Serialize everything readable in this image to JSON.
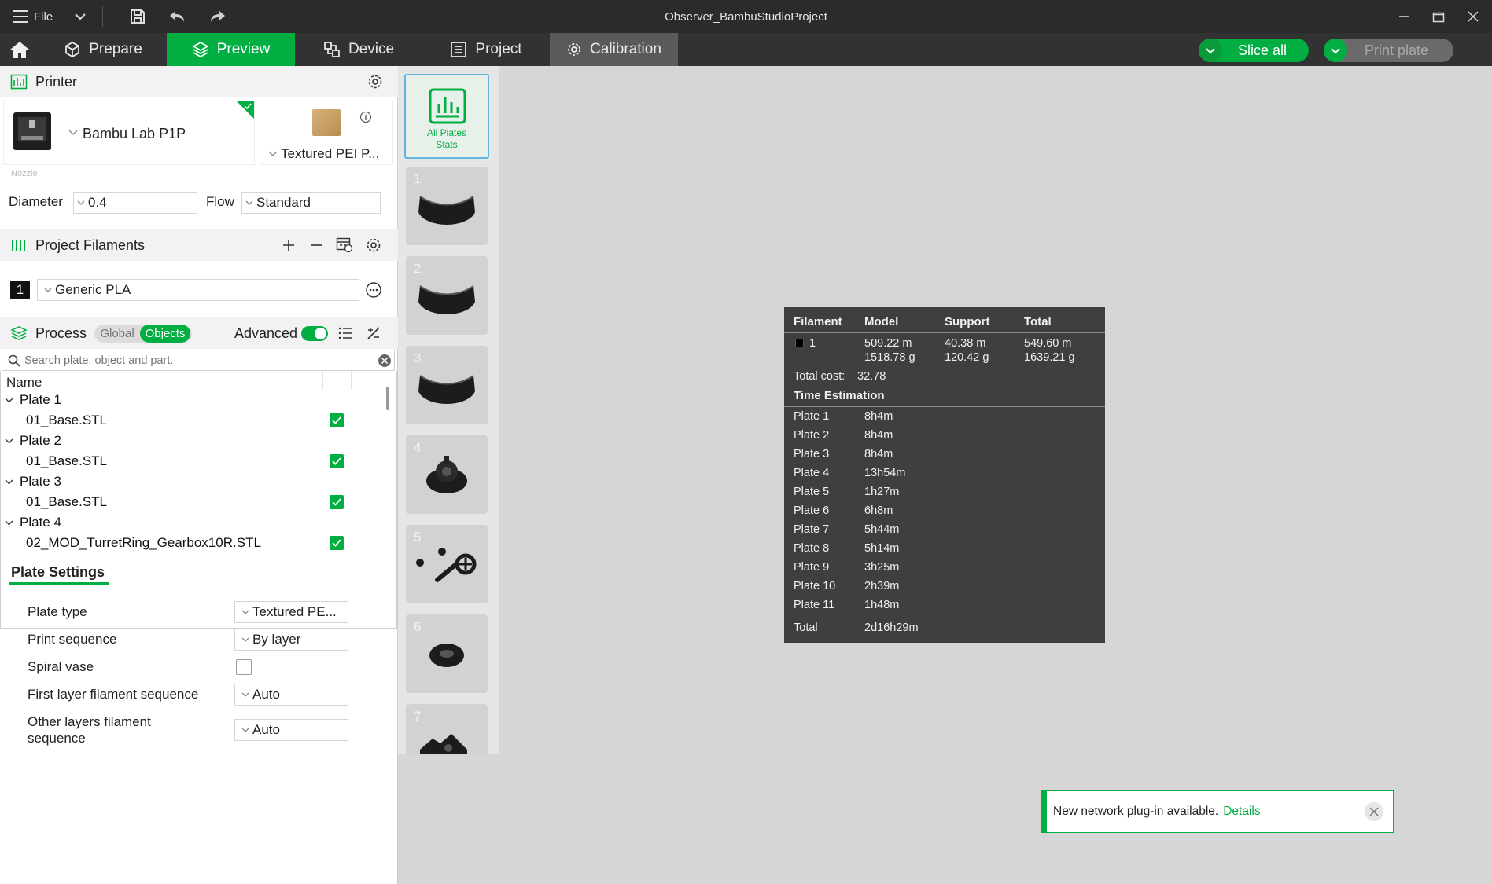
{
  "titlebar": {
    "menu_label": "File",
    "title": "Observer_BambuStudioProject"
  },
  "tabs": [
    {
      "label": "Prepare"
    },
    {
      "label": "Preview"
    },
    {
      "label": "Device"
    },
    {
      "label": "Project"
    },
    {
      "label": "Calibration"
    }
  ],
  "actions": {
    "slice_all": "Slice all",
    "print_plate": "Print plate"
  },
  "printer": {
    "header": "Printer",
    "model": "Bambu Lab P1P",
    "plate": "Textured PEI P...",
    "nozzle_label": "Nozzle",
    "diameter_label": "Diameter",
    "diameter_value": "0.4",
    "flow_label": "Flow",
    "flow_value": "Standard"
  },
  "filaments": {
    "header": "Project Filaments",
    "items": [
      {
        "index": "1",
        "name": "Generic PLA",
        "color": "#000000"
      }
    ]
  },
  "process": {
    "header": "Process",
    "global_label": "Global",
    "objects_label": "Objects",
    "advanced_label": "Advanced",
    "search_placeholder": "Search plate, object and part.",
    "name_col": "Name",
    "plates": [
      {
        "label": "Plate 1",
        "object": "01_Base.STL"
      },
      {
        "label": "Plate 2",
        "object": "01_Base.STL"
      },
      {
        "label": "Plate 3",
        "object": "01_Base.STL"
      },
      {
        "label": "Plate 4",
        "object": "02_MOD_TurretRing_Gearbox10R.STL"
      }
    ]
  },
  "plate_settings": {
    "header": "Plate Settings",
    "plate_type_label": "Plate type",
    "plate_type_value": "Textured PE...",
    "print_sequence_label": "Print sequence",
    "print_sequence_value": "By layer",
    "spiral_vase_label": "Spiral vase",
    "first_layer_label": "First layer filament sequence",
    "first_layer_value": "Auto",
    "other_layers_label_1": "Other layers filament",
    "other_layers_label_2": "sequence",
    "other_layers_value": "Auto"
  },
  "plate_strip": {
    "all_plates_line1": "All Plates",
    "all_plates_line2": "Stats",
    "numbers": [
      "1",
      "2",
      "3",
      "4",
      "5",
      "6",
      "7"
    ]
  },
  "stats": {
    "headers": {
      "filament": "Filament",
      "model": "Model",
      "support": "Support",
      "total": "Total"
    },
    "row": {
      "index": "1",
      "model_m": "509.22 m",
      "model_g": "1518.78 g",
      "support_m": "40.38 m",
      "support_g": "120.42 g",
      "total_m": "549.60 m",
      "total_g": "1639.21 g"
    },
    "total_cost_label": "Total cost:",
    "total_cost_value": "32.78",
    "time_header": "Time Estimation",
    "times": [
      {
        "plate": "Plate 1",
        "time": "8h4m"
      },
      {
        "plate": "Plate 2",
        "time": "8h4m"
      },
      {
        "plate": "Plate 3",
        "time": "8h4m"
      },
      {
        "plate": "Plate 4",
        "time": "13h54m"
      },
      {
        "plate": "Plate 5",
        "time": "1h27m"
      },
      {
        "plate": "Plate 6",
        "time": "6h8m"
      },
      {
        "plate": "Plate 7",
        "time": "5h44m"
      },
      {
        "plate": "Plate 8",
        "time": "5h14m"
      },
      {
        "plate": "Plate 9",
        "time": "3h25m"
      },
      {
        "plate": "Plate 10",
        "time": "2h39m"
      },
      {
        "plate": "Plate 11",
        "time": "1h48m"
      }
    ],
    "total_label": "Total",
    "total_time": "2d16h29m"
  },
  "notification": {
    "text": "New network plug-in available.",
    "link": "Details"
  },
  "colors": {
    "accent": "#00ae42",
    "titlebar": "#2b2b2b",
    "tabbar": "#323232",
    "stats_bg": "#3f3f3f"
  }
}
